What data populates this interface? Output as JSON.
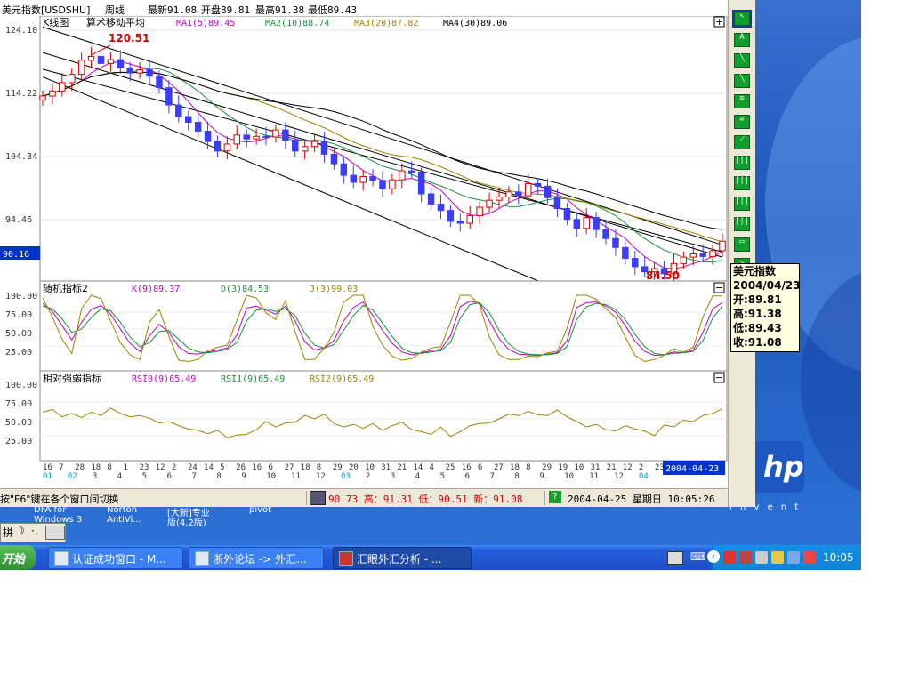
{
  "titlebar": {
    "name": "美元指数[USDSHU]",
    "period": "周线",
    "latest": "最新91.08",
    "open": "开盘89.81",
    "high": "最高91.38",
    "low": "最低89.43"
  },
  "main_panel": {
    "label": "K线图",
    "indicator_name": "算术移动平均",
    "ma1": "MA1(5)89.45",
    "ma2": "MA2(10)88.74",
    "ma3": "MA3(20)87.82",
    "ma4": "MA4(30)89.06",
    "y_ticks": [
      "124.10",
      "114.22",
      "104.34",
      "94.46"
    ],
    "current_price_label": "90.16",
    "high_annotation": "120.51",
    "low_annotation": "84.50",
    "expand_button": "+"
  },
  "kdj_panel": {
    "label": "随机指标2",
    "k": "K(9)89.37",
    "d": "D(3)84.53",
    "j": "J(3)99.03",
    "y_ticks": [
      "100.00",
      "75.00",
      "50.00",
      "25.00"
    ],
    "minimize_button": "−"
  },
  "rsi_panel": {
    "label": "相对强弱指标",
    "rsi0": "RSI0(9)65.49",
    "rsi1": "RSI1(9)65.49",
    "rsi2": "RSI2(9)65.49",
    "y_ticks": [
      "100.00",
      "75.00",
      "50.00",
      "25.00"
    ],
    "minimize_button": "−"
  },
  "date_axis": {
    "days": [
      "16",
      "7",
      "28",
      "18",
      "8",
      "1",
      "23",
      "12",
      "2",
      "24",
      "14",
      "5",
      "26",
      "16",
      "6",
      "27",
      "18",
      "8",
      "29",
      "20",
      "10",
      "31",
      "21",
      "14",
      "4",
      "25",
      "16",
      "6",
      "27",
      "18",
      "8",
      "29",
      "19",
      "10",
      "31",
      "21",
      "12",
      "2",
      "23"
    ],
    "months": [
      "01",
      "02",
      "3",
      "4",
      "5",
      "6",
      "7",
      "8",
      "9",
      "10",
      "11",
      "12",
      "03",
      "2",
      "3",
      "4",
      "5",
      "6",
      "7",
      "8",
      "9",
      "10",
      "11",
      "12",
      "04"
    ],
    "current_date": "2004-04-23"
  },
  "tooltip": {
    "title": "美元指数",
    "date": "2004/04/23",
    "open": "开:89.81",
    "high": "高:91.38",
    "low": "低:89.43",
    "close": "收:91.08"
  },
  "statusbar": {
    "hint": "按\"F6\"键在各个窗口间切换",
    "quote": "90.73 高：91.31 低：90.51 新：91.08",
    "datetime": "2004-04-25 星期日 10:05:26"
  },
  "desktop": {
    "icon_labels": [
      "DFA for",
      "Norton",
      "[大新]专业",
      "pivot",
      "Windows 3",
      "AntiVi...",
      "版(4.2版)"
    ]
  },
  "taskbar": {
    "start_label": "开始",
    "tasks": [
      "认证成功窗口 - M...",
      "浙外论坛 -> 外汇...",
      "汇眼外汇分析 - ..."
    ],
    "clock": "10:05"
  },
  "chart_data": [
    {
      "type": "candlestick",
      "title": "美元指数[USDSHU] 周线",
      "ylim": [
        84.5,
        124.1
      ],
      "y_ticks": [
        124.1,
        114.22,
        104.34,
        94.46
      ],
      "annotations": {
        "high": 120.51,
        "low": 84.5
      },
      "last_candle": {
        "date": "2004-04-23",
        "open": 89.81,
        "high": 91.38,
        "low": 89.43,
        "close": 91.08
      },
      "close_trace": [
        113.8,
        114.6,
        115.9,
        117.2,
        119.4,
        120.0,
        118.9,
        119.5,
        118.2,
        117.4,
        117.9,
        116.9,
        115.1,
        112.4,
        110.6,
        109.7,
        108.3,
        106.7,
        105.2,
        106.3,
        107.7,
        107.1,
        107.5,
        107.4,
        108.5,
        106.9,
        105.2,
        105.9,
        106.7,
        104.7,
        103.2,
        101.4,
        100.3,
        101.2,
        100.6,
        99.3,
        100.7,
        102.1,
        101.9,
        98.5,
        96.9,
        95.9,
        94.2,
        93.9,
        95.1,
        96.4,
        97.5,
        98.0,
        98.8,
        98.2,
        100.1,
        99.7,
        97.9,
        96.2,
        94.5,
        93.1,
        94.8,
        92.9,
        91.5,
        90.1,
        88.4,
        87.1,
        86.3,
        86.8,
        86.0,
        87.6,
        88.6,
        89.1,
        88.7,
        89.6,
        91.08
      ],
      "ma_lines": [
        "MA1(5)89.45",
        "MA2(10)88.74",
        "MA3(20)87.82",
        "MA4(30)89.06"
      ],
      "colors": {
        "up": "#d40000",
        "down": "#3c3cff",
        "ma1": "#c000c0",
        "ma2": "#1a8f3a",
        "ma3": "#9a8400",
        "ma4": "#000000"
      }
    },
    {
      "type": "line",
      "title": "随机指标2",
      "ylim": [
        0,
        100
      ],
      "series": [
        {
          "name": "K(9)",
          "values": [
            88,
            76,
            55,
            34,
            60,
            79,
            85,
            72,
            50,
            29,
            17,
            40,
            57,
            45,
            24,
            14,
            13,
            16,
            19,
            22,
            41,
            81,
            84,
            78,
            72,
            84,
            62,
            31,
            19,
            22,
            33,
            62,
            82,
            90,
            70,
            48,
            29,
            16,
            12,
            15,
            18,
            20,
            40,
            83,
            91,
            88,
            62,
            36,
            20,
            13,
            12,
            11,
            13,
            15,
            33,
            82,
            89,
            90,
            84,
            75,
            55,
            32,
            17,
            11,
            12,
            16,
            15,
            19,
            45,
            80,
            89
          ]
        },
        {
          "name": "D(3)",
          "values": [
            84,
            80,
            65,
            45,
            50,
            67,
            80,
            77,
            60,
            38,
            24,
            30,
            46,
            48,
            35,
            22,
            16,
            15,
            17,
            20,
            30,
            62,
            78,
            80,
            76,
            80,
            70,
            44,
            26,
            22,
            27,
            48,
            70,
            85,
            78,
            59,
            39,
            22,
            15,
            14,
            16,
            18,
            30,
            66,
            86,
            89,
            74,
            48,
            28,
            17,
            13,
            12,
            12,
            14,
            24,
            64,
            83,
            88,
            86,
            79,
            64,
            42,
            24,
            14,
            12,
            14,
            15,
            17,
            33,
            66,
            84
          ]
        },
        {
          "name": "J(3)",
          "values": [
            96,
            68,
            35,
            14,
            80,
            100,
            95,
            62,
            30,
            12,
            5,
            60,
            79,
            39,
            4,
            2,
            5,
            18,
            23,
            26,
            63,
            100,
            96,
            74,
            64,
            92,
            46,
            5,
            5,
            22,
            45,
            90,
            100,
            100,
            54,
            26,
            10,
            4,
            6,
            16,
            22,
            24,
            60,
            100,
            100,
            86,
            38,
            12,
            5,
            5,
            10,
            9,
            15,
            17,
            51,
            100,
            100,
            94,
            80,
            67,
            38,
            11,
            2,
            5,
            11,
            21,
            16,
            23,
            68,
            99,
            99
          ]
        }
      ],
      "colors": {
        "K": "#c000c0",
        "D": "#1a8f3a",
        "J": "#9a8400"
      }
    },
    {
      "type": "line",
      "title": "相对强弱指标",
      "ylim": [
        0,
        100
      ],
      "series": [
        {
          "name": "RSI0(9)",
          "values": [
            60,
            64,
            53,
            58,
            52,
            60,
            55,
            66,
            58,
            53,
            55,
            51,
            44,
            46,
            40,
            35,
            33,
            28,
            33,
            22,
            26,
            27,
            34,
            46,
            38,
            44,
            45,
            55,
            50,
            57,
            43,
            38,
            42,
            36,
            43,
            33,
            40,
            45,
            34,
            31,
            27,
            38,
            24,
            31,
            40,
            43,
            44,
            50,
            57,
            55,
            61,
            56,
            55,
            63,
            53,
            46,
            38,
            42,
            34,
            32,
            40,
            35,
            32,
            25,
            41,
            38,
            48,
            46,
            55,
            58,
            65
          ]
        }
      ],
      "colors": {
        "RSI0": "#9a8400"
      }
    }
  ]
}
